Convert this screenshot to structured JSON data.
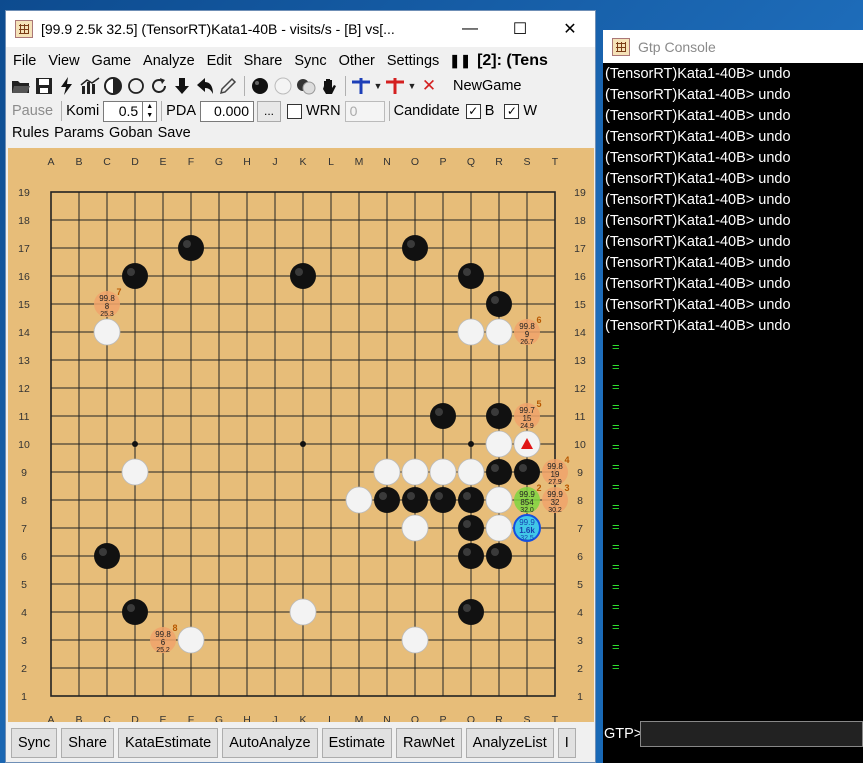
{
  "window": {
    "title": "[99.9 2.5k 32.5] (TensorRT)Kata1-40B - visits/s - [B] vs[...",
    "minimize": "—",
    "maximize": "☐",
    "close": "✕"
  },
  "menu": {
    "items": [
      "File",
      "View",
      "Game",
      "Analyze",
      "Edit",
      "Share",
      "Sync",
      "Other",
      "Settings"
    ],
    "pause_glyph": "❚❚",
    "engine_status": "[2]: (Tens"
  },
  "toolbar1": {
    "icons": [
      "open-icon",
      "save-icon",
      "flash-icon",
      "chart-icon",
      "auto-play-icon",
      "circle-icon",
      "cycle-icon",
      "down-arrow-icon",
      "back-icon",
      "pencil-icon",
      "black-stone-icon",
      "white-stone-icon",
      "mixed-stone-icon",
      "hand-icon",
      "blue-cross-icon",
      "red-cross-icon",
      "clear-icon"
    ],
    "new_game": "NewGame"
  },
  "toolbar2": {
    "pause": "Pause",
    "komi_label": "Komi",
    "komi_value": "0.5",
    "pda_label": "PDA",
    "pda_value": "0.000",
    "pda_more": "...",
    "wrn_label": "WRN",
    "wrn_value": "0",
    "candidate_label": "Candidate",
    "b_label": "B",
    "w_label": "W"
  },
  "toolbar3": {
    "items": [
      "Rules",
      "Params",
      "Goban",
      "Save"
    ]
  },
  "board": {
    "columns": [
      "A",
      "B",
      "C",
      "D",
      "E",
      "F",
      "G",
      "H",
      "J",
      "K",
      "L",
      "M",
      "N",
      "O",
      "P",
      "Q",
      "R",
      "S",
      "T"
    ],
    "rows": [
      "19",
      "18",
      "17",
      "16",
      "15",
      "14",
      "13",
      "12",
      "11",
      "10",
      "9",
      "8",
      "7",
      "6",
      "5",
      "4",
      "3",
      "2",
      "1"
    ],
    "black_stones": [
      "F17",
      "O17",
      "D16",
      "K16",
      "Q16",
      "R15",
      "P11",
      "R11",
      "R9",
      "S9",
      "N8",
      "O8",
      "P8",
      "Q8",
      "Q7",
      "Q6",
      "R6",
      "C6",
      "D4",
      "Q4"
    ],
    "white_stones": [
      "C14",
      "Q14",
      "R14",
      "R10",
      "D9",
      "N9",
      "O9",
      "P9",
      "Q9",
      "M8",
      "R8",
      "O7",
      "R7",
      "K4",
      "F3",
      "O3"
    ],
    "last_move": "S10",
    "candidates": [
      {
        "pos": "C15",
        "win": "99.8",
        "visits": "8",
        "score": "25.3",
        "rank": "7",
        "color": "#f0a36b"
      },
      {
        "pos": "S14",
        "win": "99.8",
        "visits": "9",
        "score": "26.7",
        "rank": "6",
        "color": "#f0a36b"
      },
      {
        "pos": "S11",
        "win": "99.7",
        "visits": "15",
        "score": "24.9",
        "rank": "5",
        "color": "#f0a36b"
      },
      {
        "pos": "T9",
        "win": "99.8",
        "visits": "19",
        "score": "27.9",
        "rank": "4",
        "color": "#f0a36b"
      },
      {
        "pos": "T8",
        "win": "99.9",
        "visits": "32",
        "score": "30.2",
        "rank": "3",
        "color": "#f0a36b"
      },
      {
        "pos": "S8",
        "win": "99.9",
        "visits": "854",
        "score": "32.0",
        "rank": "2",
        "color": "#7ed640"
      },
      {
        "pos": "S7",
        "win": "99.9",
        "visits": "1.6k",
        "score": "32.5",
        "rank": "",
        "color": "#41c8e8"
      },
      {
        "pos": "E3",
        "win": "99.8",
        "visits": "6",
        "score": "25.2",
        "rank": "8",
        "color": "#f0a36b"
      }
    ],
    "star_points": [
      "D10",
      "K10",
      "Q10"
    ]
  },
  "bottom_buttons": [
    "Sync",
    "Share",
    "KataEstimate",
    "AutoAnalyze",
    "Estimate",
    "RawNet",
    "AnalyzeList",
    "I"
  ],
  "side_marker": "P",
  "gtp": {
    "title": "Gtp Console",
    "lines": [
      "(TensorRT)Kata1-40B> undo",
      "(TensorRT)Kata1-40B> undo",
      "(TensorRT)Kata1-40B> undo",
      "(TensorRT)Kata1-40B> undo",
      "(TensorRT)Kata1-40B> undo",
      "(TensorRT)Kata1-40B> undo",
      "(TensorRT)Kata1-40B> undo",
      "(TensorRT)Kata1-40B> undo",
      "(TensorRT)Kata1-40B> undo",
      "(TensorRT)Kata1-40B> undo",
      "(TensorRT)Kata1-40B> undo",
      "(TensorRT)Kata1-40B> undo",
      "(TensorRT)Kata1-40B> undo"
    ],
    "responses": [
      "=",
      "=",
      "=",
      "=",
      "=",
      "=",
      "=",
      "=",
      "=",
      "=",
      "=",
      "=",
      "=",
      "=",
      "=",
      "=",
      "="
    ],
    "prompt": "GTP>"
  }
}
